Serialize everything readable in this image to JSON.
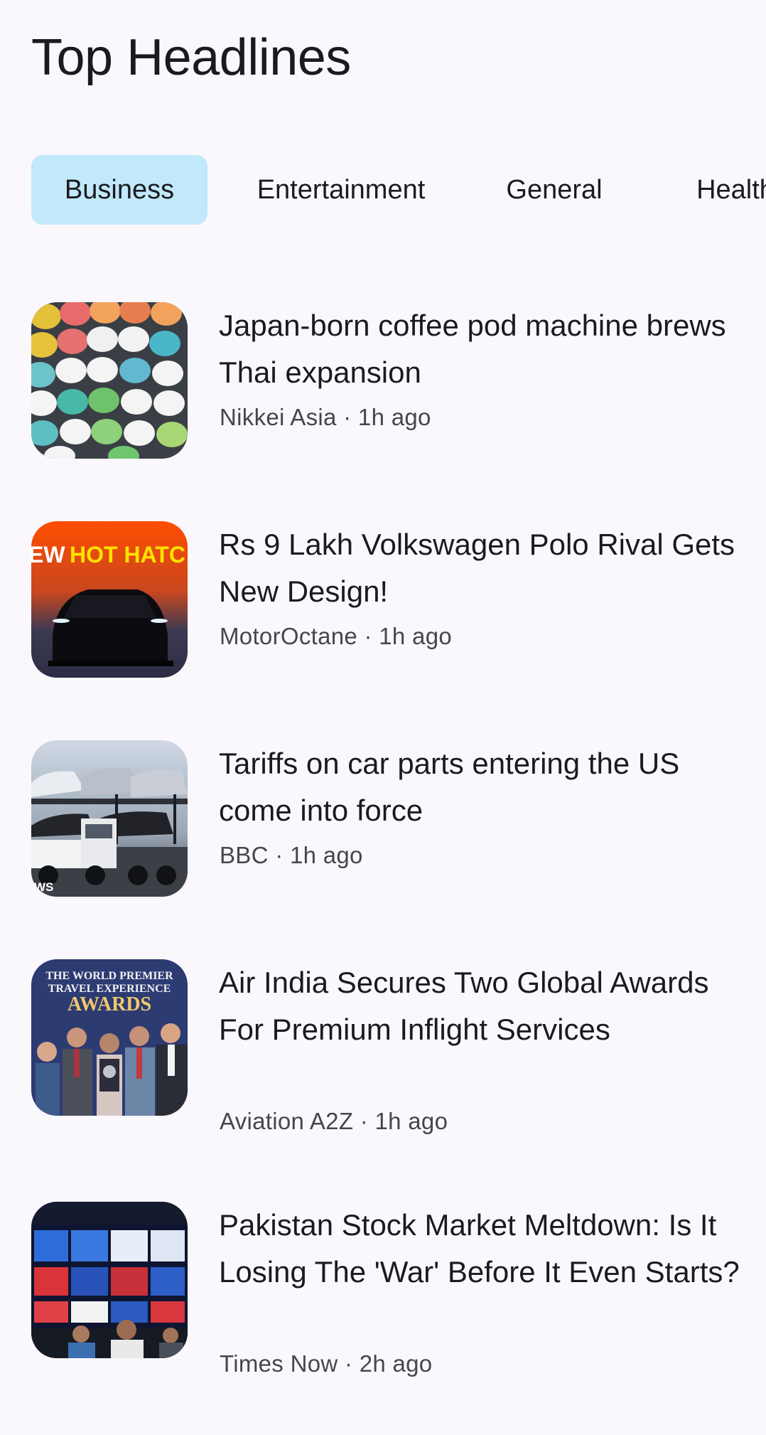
{
  "header": {
    "title": "Top Headlines"
  },
  "tabs": [
    {
      "label": "Business",
      "selected": true
    },
    {
      "label": "Entertainment",
      "selected": false
    },
    {
      "label": "General",
      "selected": false
    },
    {
      "label": "Health",
      "selected": false
    }
  ],
  "articles": [
    {
      "title": "Japan-born coffee pod machine brews Thai expansion",
      "source": "Nikkei Asia",
      "time": "1h ago",
      "meta": "Nikkei Asia · 1h ago",
      "thumbnail": "coffee-pods-image"
    },
    {
      "title": "Rs 9 Lakh Volkswagen Polo Rival Gets New Design!",
      "source": "MotorOctane",
      "time": "1h ago",
      "meta": "MotorOctane · 1h ago",
      "thumbnail": "car-teaser-image",
      "thumbnail_text": "EW HOT HATC"
    },
    {
      "title": "Tariffs on car parts entering the US come into force",
      "source": "BBC",
      "time": "1h ago",
      "meta": "BBC · 1h ago",
      "thumbnail": "car-transporter-image",
      "thumbnail_text": "WS"
    },
    {
      "title": "Air India Secures Two Global Awards For Premium Inflight Services",
      "source": "Aviation A2Z",
      "time": "1h ago",
      "meta": "Aviation A2Z · 1h ago",
      "thumbnail": "awards-ceremony-image",
      "thumbnail_text_1": "THE WORLD PREMIER",
      "thumbnail_text_2": "TRAVEL EXPERIENCE",
      "thumbnail_text_3": "AWARDS"
    },
    {
      "title": "Pakistan Stock Market Meltdown: Is It Losing The 'War' Before It Even Starts?",
      "source": "Times Now",
      "time": "2h ago",
      "meta": "Times Now · 2h ago",
      "thumbnail": "stock-exchange-image"
    }
  ],
  "colors": {
    "background": "#fbf8fd",
    "selected_tab": "#c1e8fb",
    "text_primary": "#1b1b1f",
    "text_secondary": "#45464f"
  }
}
